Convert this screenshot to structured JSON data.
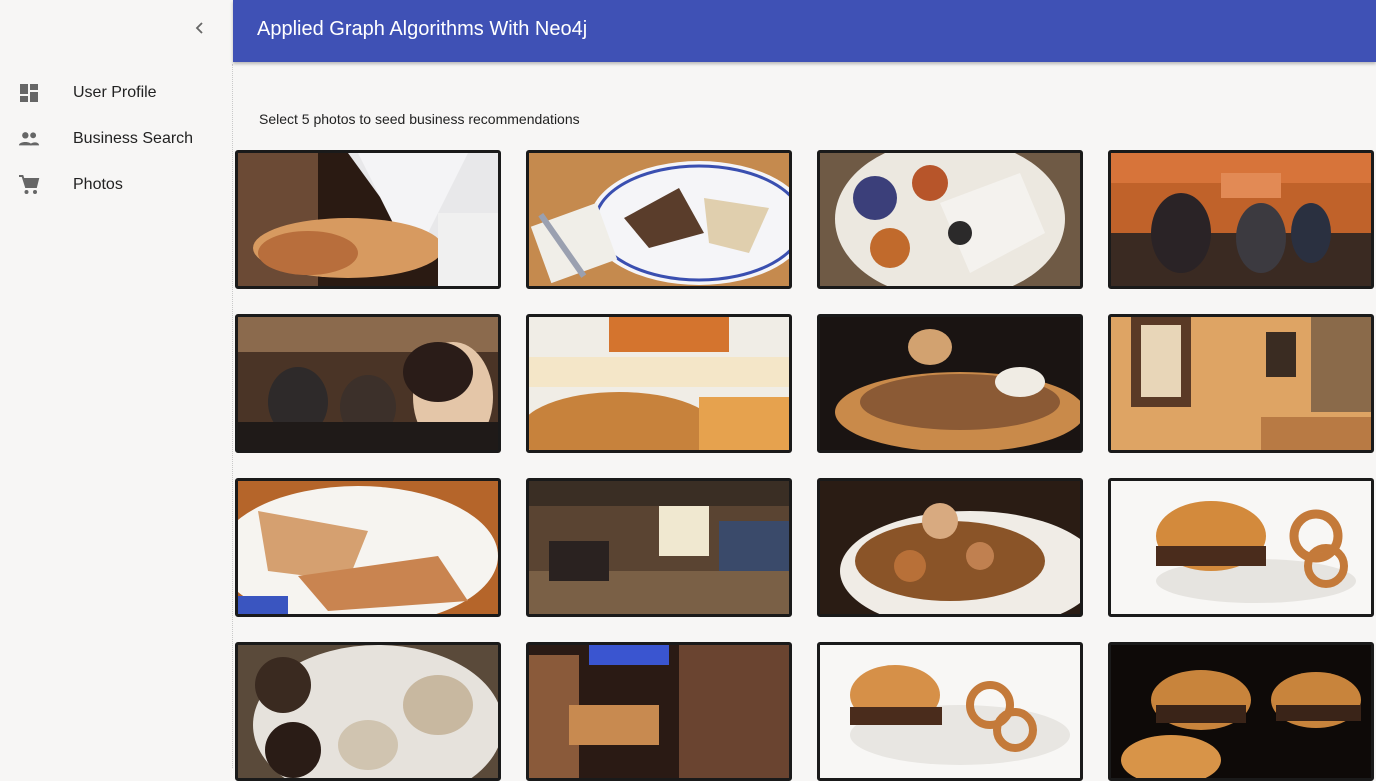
{
  "app": {
    "title": "Applied Graph Algorithms With Neo4j"
  },
  "sidebar": {
    "collapse_icon": "chevron-left-icon",
    "items": [
      {
        "label": "User Profile",
        "icon": "dashboard-icon"
      },
      {
        "label": "Business Search",
        "icon": "people-icon"
      },
      {
        "label": "Photos",
        "icon": "cart-icon"
      }
    ]
  },
  "main": {
    "instruction": "Select 5 photos to seed business recommendations"
  },
  "colors": {
    "appbar": "#3f51b5",
    "background": "#f7f6f5",
    "text": "#222222"
  },
  "photos": [
    {
      "subject": "martini glass with fried appetizer"
    },
    {
      "subject": "quesadilla on plate"
    },
    {
      "subject": "bowl with blueberries"
    },
    {
      "subject": "Cane's restaurant interior"
    },
    {
      "subject": "diners in restaurant"
    },
    {
      "subject": "burger and fries in wrapper"
    },
    {
      "subject": "plate of nachos"
    },
    {
      "subject": "restaurant wall with mirror"
    },
    {
      "subject": "tacos on plate"
    },
    {
      "subject": "restaurant bar interior"
    },
    {
      "subject": "sauteed mushrooms"
    },
    {
      "subject": "burger with onion rings"
    },
    {
      "subject": "oysters with sauces"
    },
    {
      "subject": "restaurant patio at night"
    },
    {
      "subject": "burger with onion rings"
    },
    {
      "subject": "burgers and chicken nuggets"
    }
  ]
}
